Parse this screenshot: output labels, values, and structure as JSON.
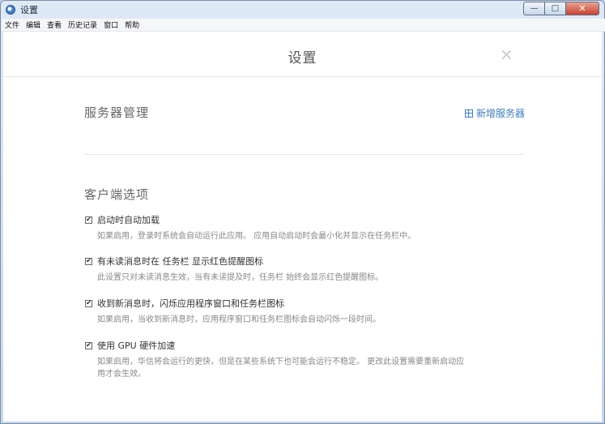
{
  "window": {
    "title": "设置",
    "buttons": {
      "minimize": "—",
      "maximize": "□",
      "close": "✕"
    }
  },
  "menu": [
    "文件",
    "编辑",
    "查看",
    "历史记录",
    "窗口",
    "帮助"
  ],
  "dialog": {
    "title": "设置",
    "close_symbol": "×"
  },
  "server_section": {
    "title": "服务器管理",
    "add_label": "新增服务器"
  },
  "client_section": {
    "title": "客户端选项",
    "options": [
      {
        "label": "启动时自动加载",
        "checked": true,
        "description": "如果启用，登录时系统会自动运行此应用。 应用自动启动时会最小化并显示在任务栏中。"
      },
      {
        "label": "有未读消息时在 任务栏 显示红色提醒图标",
        "checked": true,
        "description": "此设置只对未读消息生效，当有未读提及时，任务栏 始终会显示红色提醒图标。"
      },
      {
        "label": "收到新消息时，闪烁应用程序窗口和任务栏图标",
        "checked": true,
        "description": "如果启用，当收到新消息时，应用程序窗口和任务栏图标会自动闪烁一段时间。"
      },
      {
        "label": "使用 GPU 硬件加速",
        "checked": true,
        "description": "如果启用，华信将会运行的更快，但是在某些系统下也可能会运行不稳定。 更改此设置需要重新启动应用才会生效。"
      }
    ],
    "check_mark": "✔"
  }
}
